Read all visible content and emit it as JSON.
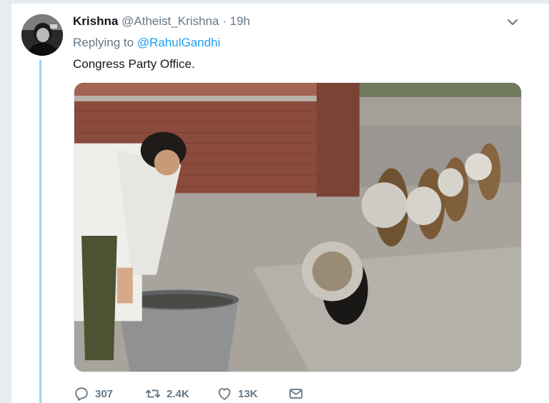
{
  "tweet": {
    "author_name": "Krishna",
    "author_handle": "@Atheist_Krishna",
    "separator": "·",
    "timestamp": "19h",
    "replying_prefix": "Replying to",
    "replying_to": "@RahulGandhi",
    "text": "Congress Party Office."
  },
  "actions": {
    "replies": "307",
    "retweets": "2.4K",
    "likes": "13K"
  },
  "icons": {
    "menu": "chevron-down-icon",
    "reply": "reply-icon",
    "retweet": "retweet-icon",
    "like": "heart-icon",
    "message": "envelope-icon"
  },
  "colors": {
    "link": "#1da1f2",
    "muted": "#657786",
    "thread_line": "#9ad3f5"
  }
}
